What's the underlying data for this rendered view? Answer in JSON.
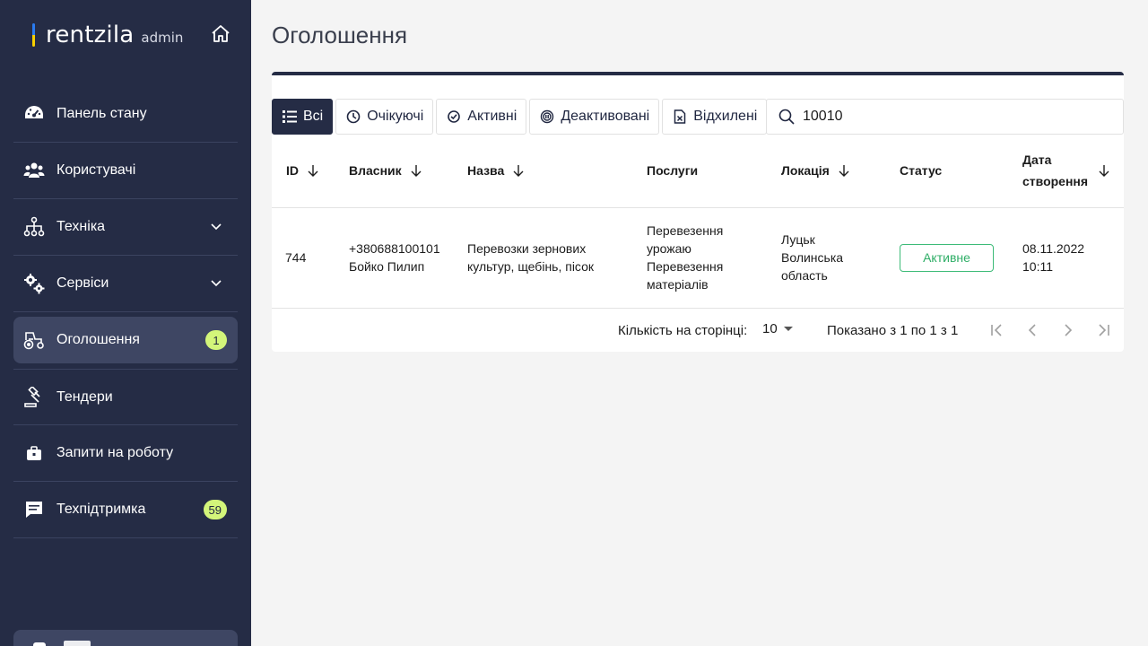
{
  "sidebar": {
    "logo": {
      "word": "rentzila",
      "sub": "admin"
    },
    "items": [
      {
        "label": "Панель стану",
        "icon": "dashboard-gauge-icon"
      },
      {
        "label": "Користувачі",
        "icon": "users-icon"
      },
      {
        "label": "Техніка",
        "icon": "hierarchy-icon",
        "expandable": true
      },
      {
        "label": "Сервіси",
        "icon": "gears-icon",
        "expandable": true
      },
      {
        "label": "Оголошення",
        "icon": "tractor-icon",
        "badge": "1",
        "active": true
      },
      {
        "label": "Тендери",
        "icon": "gavel-icon"
      },
      {
        "label": "Запити на роботу",
        "icon": "briefcase-icon"
      },
      {
        "label": "Техпідтримка",
        "icon": "chat-icon",
        "badge": "59"
      }
    ]
  },
  "main": {
    "title": "Оголошення",
    "filters": [
      {
        "label": "Всі",
        "icon": "list-icon",
        "active": true
      },
      {
        "label": "Очікуючі",
        "icon": "clock-icon"
      },
      {
        "label": "Активні",
        "icon": "check-circle-icon"
      },
      {
        "label": "Деактивовані",
        "icon": "pause-circle-icon"
      },
      {
        "label": "Відхилені",
        "icon": "file-x-icon"
      }
    ],
    "search": {
      "value": "10010",
      "placeholder": ""
    },
    "table": {
      "columns": [
        {
          "label": "ID",
          "sortable": true
        },
        {
          "label": "Власник",
          "sortable": true
        },
        {
          "label": "Назва",
          "sortable": true
        },
        {
          "label": "Послуги",
          "sortable": false
        },
        {
          "label": "Локація",
          "sortable": true
        },
        {
          "label": "Статус",
          "sortable": false
        },
        {
          "label": "Дата створення",
          "sortable": true
        }
      ],
      "rows": [
        {
          "id": "744",
          "owner_phone": "+380688100101",
          "owner_name": "Бойко Пилип",
          "title": "Перевозки зернових культур, щебінь, пісок",
          "services": [
            "Перевезення урожаю",
            "Перевезення матеріалів"
          ],
          "location": "Луцьк Волинська область",
          "status": "Активне",
          "date": "08.11.2022",
          "time": "10:11"
        }
      ]
    },
    "pager": {
      "rows_per_page_label": "Кількість на сторінці:",
      "rows_per_page": "10",
      "range_text": "Показано з 1 по 1 з 1"
    }
  },
  "colors": {
    "sidebar_bg": "#252c45",
    "sidebar_active": "#3e4663",
    "badge_bg": "#d3f57a",
    "status_active": "#2fae67"
  }
}
